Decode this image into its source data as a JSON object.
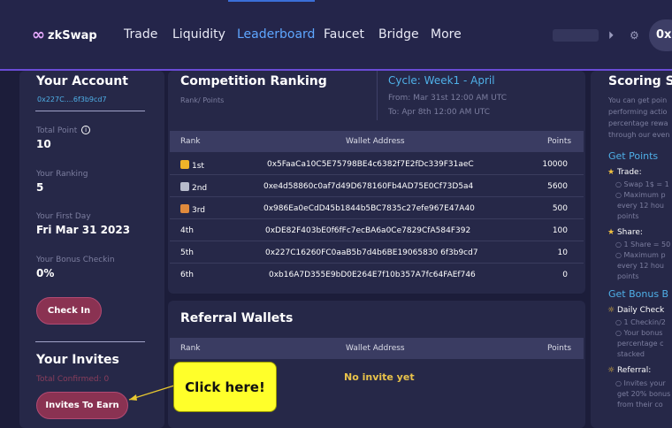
{
  "brand": {
    "name": "zkSwap",
    "symbol": "∞"
  },
  "nav": {
    "items": [
      "Trade",
      "Liquidity",
      "Leaderboard",
      "Faucet",
      "Bridge",
      "More"
    ],
    "active": "Leaderboard"
  },
  "header": {
    "avatar_text": "0x"
  },
  "account": {
    "title": "Your Account",
    "address": "0x227C....6f3b9cd7",
    "total_point_label": "Total Point",
    "total_point_value": "10",
    "ranking_label": "Your Ranking",
    "ranking_value": "5",
    "first_day_label": "Your First Day",
    "first_day_value": "Fri Mar 31 2023",
    "bonus_label": "Your Bonus Checkin",
    "bonus_value": "0%",
    "checkin_button": "Check In",
    "invites_title": "Your Invites",
    "total_confirmed": "Total Confirmed: 0",
    "invite_button": "Invites To Earn"
  },
  "ranking": {
    "title": "Competition Ranking",
    "subtitle": "Rank/ Points",
    "cycle": "Cycle: Week1 - April",
    "from": "From: Mar 31st 12:00 AM UTC",
    "to": "To: Apr 8th 12:00 AM UTC",
    "columns": {
      "rank": "Rank",
      "wallet": "Wallet Address",
      "points": "Points"
    },
    "rows": [
      {
        "rank": "1st",
        "wallet": "0x5FaaCa10C5E75798BE4c6382f7E2fDc339F31aeC",
        "points": "10000",
        "medal": "#f0b429"
      },
      {
        "rank": "2nd",
        "wallet": "0xe4d58860c0af7d49D678160Fb4AD75E0Cf73D5a4",
        "points": "5600",
        "medal": "#b8bccc"
      },
      {
        "rank": "3rd",
        "wallet": "0x986Ea0eCdD45b1844b5BC7835c27efe967E47A40",
        "points": "500",
        "medal": "#e08a3c"
      },
      {
        "rank": "4th",
        "wallet": "0xDE82F403bE0f6fFc7ecBA6a0Ce7829CfA584F392",
        "points": "100"
      },
      {
        "rank": "5th",
        "wallet": "0x227C16260FC0aaB5b7d4b6BE19065830 6f3b9cd7",
        "points": "10"
      },
      {
        "rank": "6th",
        "wallet": "0xb16A7D355E9bD0E264E7f10b357A7fc64FAEf746",
        "points": "0"
      }
    ]
  },
  "referral": {
    "title": "Referral Wallets",
    "columns": {
      "rank": "Rank",
      "wallet": "Wallet Address",
      "points": "Points"
    },
    "empty": "No invite yet"
  },
  "scoring": {
    "title": "Scoring St",
    "intro": [
      "You can get poin",
      "performing actio",
      "percentage rewa",
      "through our even"
    ],
    "get_points": "Get Points",
    "trade_label": "Trade:",
    "trade_lines": [
      "Swap 1$ = 1",
      "Maximum p",
      "every 12 hou",
      "points"
    ],
    "share_label": "Share:",
    "share_lines": [
      "1 Share = 50",
      "Maximum p",
      "every 12 hou",
      "points"
    ],
    "bonus_title": "Get Bonus B",
    "daily_label": "Daily Check",
    "daily_lines": [
      "1 Checkin/2",
      "Your bonus",
      "percentage c",
      "stacked"
    ],
    "referral_label": "Referral:",
    "referral_lines": [
      "Invites your",
      "get 20% bonus",
      "from their co"
    ]
  },
  "callout": {
    "text": "Click here!"
  },
  "colors": {
    "accent": "#5ea6ff",
    "button": "#8a3252",
    "gold": "#e8c24a",
    "callout": "#ffff2a"
  }
}
